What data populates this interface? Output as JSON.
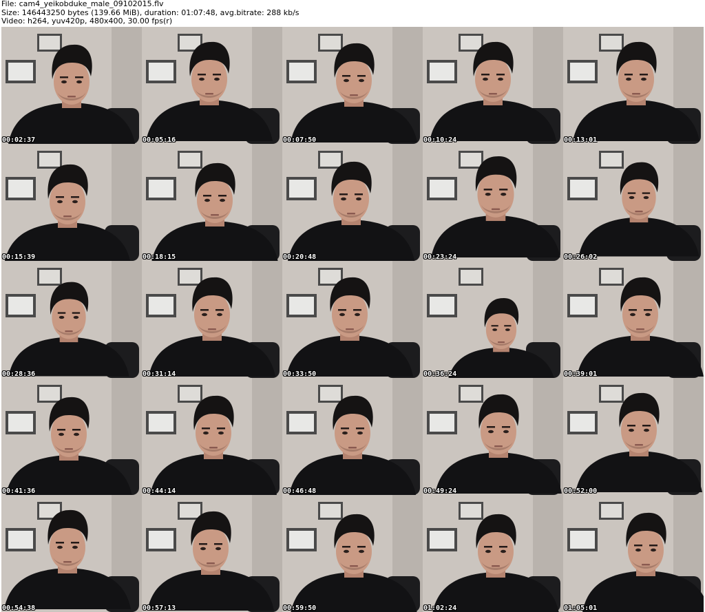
{
  "header": {
    "file_line": "File: cam4_yeikobduke_male_09102015.flv",
    "size_line": "Size: 146443250 bytes (139.66 MiB), duration: 01:07:48, avg.bitrate: 288 kb/s",
    "video_line": "Video: h264, yuv420p, 480x400, 30.00 fps(r)"
  },
  "thumbnails": [
    {
      "time": "00:02:37"
    },
    {
      "time": "00:05:16"
    },
    {
      "time": "00:07:50"
    },
    {
      "time": "00:10:24"
    },
    {
      "time": "00:13:01"
    },
    {
      "time": "00:15:39"
    },
    {
      "time": "00:18:15"
    },
    {
      "time": "00:20:48"
    },
    {
      "time": "00:23:24"
    },
    {
      "time": "00:26:02"
    },
    {
      "time": "00:28:36"
    },
    {
      "time": "00:31:14"
    },
    {
      "time": "00:33:50"
    },
    {
      "time": "00:36:24"
    },
    {
      "time": "00:39:01"
    },
    {
      "time": "00:41:36"
    },
    {
      "time": "00:44:14"
    },
    {
      "time": "00:46:48"
    },
    {
      "time": "00:49:24"
    },
    {
      "time": "00:52:00"
    },
    {
      "time": "00:54:38"
    },
    {
      "time": "00:57:13"
    },
    {
      "time": "00:59:50"
    },
    {
      "time": "01:02:24"
    },
    {
      "time": "01:05:01"
    }
  ],
  "colors": {
    "wall": "#cbc5bf",
    "shirt": "#121214",
    "hair": "#151313",
    "skin": "#c99a84",
    "frame": "#4a4a4a",
    "timestamp": "#ffffff"
  }
}
